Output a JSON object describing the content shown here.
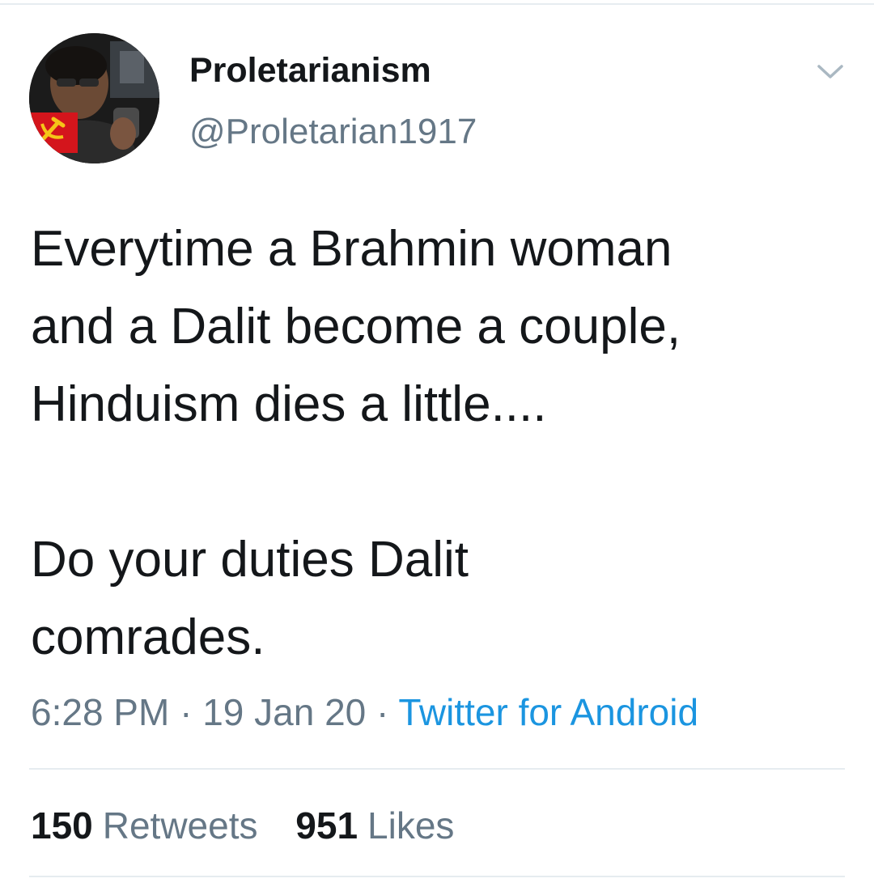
{
  "tweet": {
    "display_name": "Proletarianism",
    "handle": "@Proletarian1917",
    "text_lines": [
      "Everytime a Brahmin woman",
      "and a Dalit become a couple,",
      "Hinduism dies a little...."
    ],
    "text_lines_2": [
      "Do your duties Dalit",
      "comrades."
    ],
    "time": "6:28 PM",
    "separator": "·",
    "date": "19 Jan 20",
    "source": "Twitter for Android"
  },
  "stats": {
    "retweets_count": "150",
    "retweets_label": "Retweets",
    "likes_count": "951",
    "likes_label": "Likes"
  },
  "icons": {
    "menu": "chevron-down-icon",
    "avatar_badge": "hammer-sickle-icon"
  },
  "colors": {
    "text": "#14171a",
    "secondary": "#657786",
    "link": "#1b95e0",
    "divider": "#e6ecf0"
  }
}
